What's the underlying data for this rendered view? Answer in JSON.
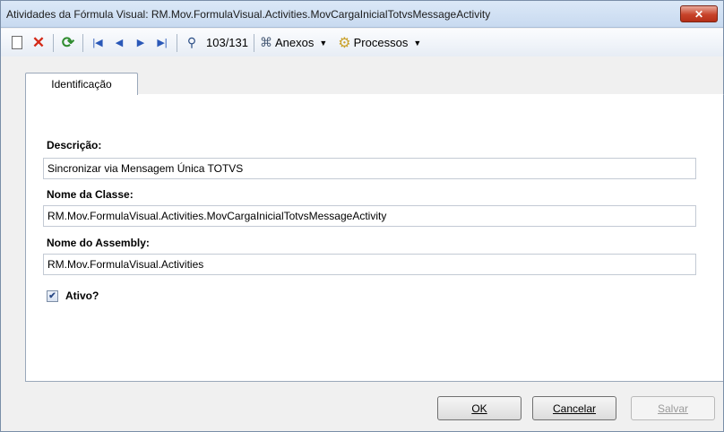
{
  "window": {
    "title": "Atividades da Fórmula Visual: RM.Mov.FormulaVisual.Activities.MovCargaInicialTotvsMessageActivity",
    "close_label": "✕"
  },
  "toolbar": {
    "record_count": "103/131",
    "attachments_label": "Anexos",
    "processes_label": "Processos"
  },
  "tabs": [
    {
      "label": "Identificação",
      "active": true
    }
  ],
  "form": {
    "description_label": "Descrição:",
    "description_value": "Sincronizar via Mensagem Única TOTVS",
    "class_label": "Nome da Classe:",
    "class_value": "RM.Mov.FormulaVisual.Activities.MovCargaInicialTotvsMessageActivity",
    "assembly_label": "Nome do Assembly:",
    "assembly_value": "RM.Mov.FormulaVisual.Activities",
    "active_label": "Ativo?",
    "active_checked": true
  },
  "footer": {
    "ok_label": "OK",
    "cancel_label": "Cancelar",
    "save_label": "Salvar"
  },
  "colors": {
    "close_button": "#c7432a",
    "delete_icon": "#d42a18",
    "refresh_icon": "#2f8c2f",
    "nav_icon": "#2a58b8"
  }
}
